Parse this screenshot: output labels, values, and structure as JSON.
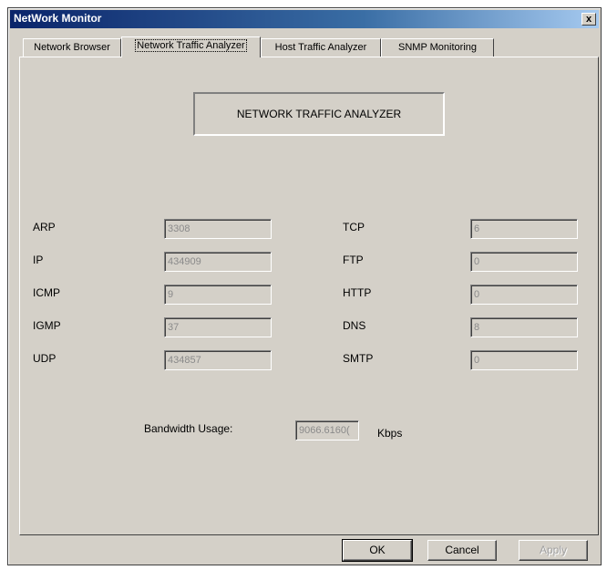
{
  "window": {
    "title": "NetWork Monitor",
    "close_label": "x"
  },
  "tabs": [
    {
      "label": "Network Browser",
      "active": false
    },
    {
      "label": "Network Traffic Analyzer",
      "active": true
    },
    {
      "label": "Host Traffic Analyzer",
      "active": false
    },
    {
      "label": "SNMP Monitoring",
      "active": false
    }
  ],
  "panel": {
    "heading": "NETWORK TRAFFIC ANALYZER",
    "left_stats": [
      {
        "label": "ARP",
        "value": "3308"
      },
      {
        "label": "IP",
        "value": "434909"
      },
      {
        "label": "ICMP",
        "value": "9"
      },
      {
        "label": "IGMP",
        "value": "37"
      },
      {
        "label": "UDP",
        "value": "434857"
      }
    ],
    "right_stats": [
      {
        "label": "TCP",
        "value": "6"
      },
      {
        "label": "FTP",
        "value": "0"
      },
      {
        "label": "HTTP",
        "value": "0"
      },
      {
        "label": "DNS",
        "value": "8"
      },
      {
        "label": "SMTP",
        "value": "0"
      }
    ],
    "bandwidth": {
      "label": "Bandwidth Usage:",
      "value": "9066.6160(",
      "unit": "Kbps"
    }
  },
  "buttons": {
    "ok": "OK",
    "cancel": "Cancel",
    "apply": "Apply"
  }
}
